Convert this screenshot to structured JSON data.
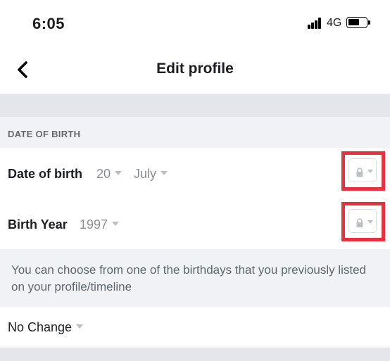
{
  "status_bar": {
    "time": "6:05",
    "network": "4G",
    "battery_level": 0.55
  },
  "nav": {
    "title": "Edit profile",
    "back_icon": "chevron-left-icon"
  },
  "section": {
    "header": "DATE OF BIRTH"
  },
  "date_row": {
    "label": "Date of birth",
    "day": "20",
    "month": "July",
    "privacy_icon": "lock-icon"
  },
  "year_row": {
    "label": "Birth Year",
    "year": "1997",
    "privacy_icon": "lock-icon"
  },
  "info": {
    "text": "You can choose from one of the birthdays that you previously listed on your profile/timeline"
  },
  "change_select": {
    "value": "No Change"
  },
  "colors": {
    "highlight": "#e5323e",
    "muted_text": "#8a8d91",
    "band": "#e4e6eb"
  }
}
